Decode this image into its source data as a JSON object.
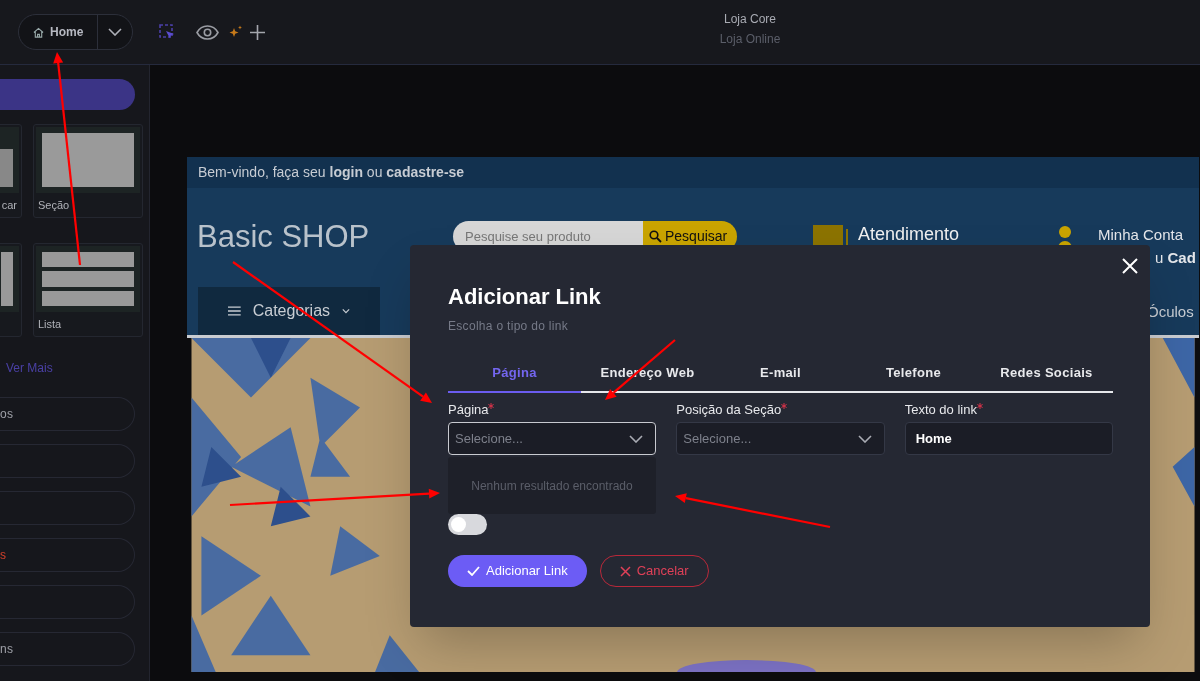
{
  "toolbar": {
    "page_button": "Home",
    "title": "Loja Core",
    "subtitle": "Loja Online"
  },
  "sidebar": {
    "blocks": [
      {
        "kind": "split",
        "label": "car"
      },
      {
        "kind": "section",
        "label": "Seção"
      },
      {
        "kind": "column"
      },
      {
        "kind": "list",
        "label": "Lista"
      }
    ],
    "see_more": "Ver Mais",
    "menu": [
      {
        "kind": "labeled",
        "label": "os",
        "highlight": false
      },
      {
        "kind": "empty"
      },
      {
        "kind": "empty"
      },
      {
        "kind": "labeled",
        "label": "s",
        "highlight": true
      },
      {
        "kind": "empty"
      },
      {
        "kind": "labeled",
        "label": "ns",
        "highlight": false
      }
    ]
  },
  "preview": {
    "welcome": "Bem-vindo, faça seu **login** ou **cadastre-se**",
    "logo": "Basic SHOP",
    "search_placeholder": "Pesquise seu produto",
    "search_button": "Pesquisar",
    "service": "Atendimento",
    "account": "Minha Conta",
    "account_links": "u **Cad**",
    "categories": "Categorias",
    "nav_item": "Óculos"
  },
  "modal": {
    "title": "Adicionar Link",
    "subtitle": "Escolha o tipo do link",
    "tabs": [
      {
        "label": "Página",
        "selected": true
      },
      {
        "label": "Endereço Web",
        "selected": false
      },
      {
        "label": "E-mail",
        "selected": false
      },
      {
        "label": "Telefone",
        "selected": false
      },
      {
        "label": "Redes Sociais",
        "selected": false
      }
    ],
    "fields": [
      {
        "kind": "select",
        "label": "Página",
        "required": true,
        "placeholder": "Selecione...",
        "focused": true
      },
      {
        "kind": "select",
        "label": "Posição da Seção",
        "required": true,
        "placeholder": "Selecione...",
        "focused": false
      },
      {
        "kind": "text",
        "label": "Texto do link",
        "required": true,
        "value": "Home",
        "focused": false
      }
    ],
    "dropdown_empty": "Nenhum resultado encontrado",
    "toggle": {
      "on": false
    },
    "submit": "Adicionar Link",
    "cancel": "Cancelar"
  }
}
